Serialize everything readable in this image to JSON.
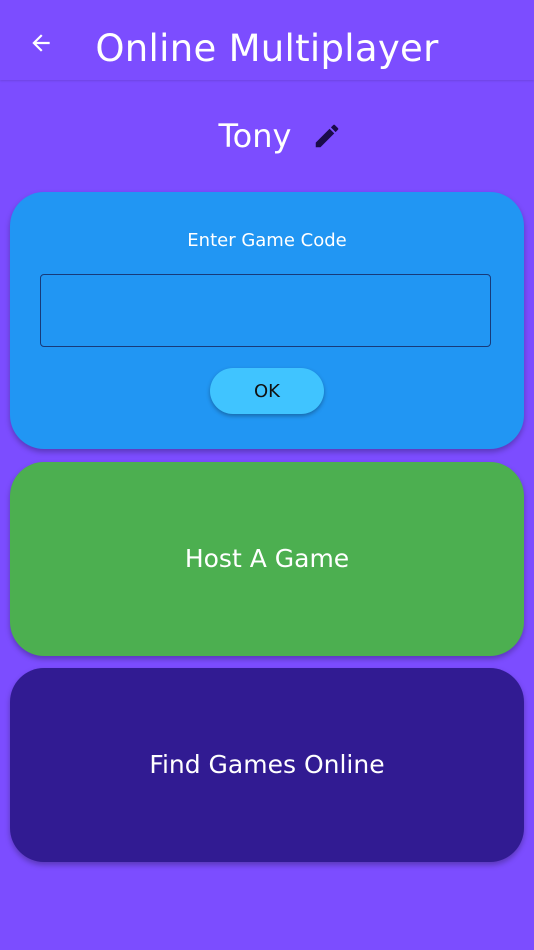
{
  "app_bar": {
    "title": "Online Multiplayer",
    "back_icon": "arrow-left-icon"
  },
  "player": {
    "name": "Tony",
    "edit_icon": "pencil-icon"
  },
  "join_card": {
    "label": "Enter Game Code",
    "input_value": "",
    "ok_label": "OK"
  },
  "host_card": {
    "label": "Host A Game"
  },
  "find_card": {
    "label": "Find Games Online"
  },
  "colors": {
    "background": "#7c4dff",
    "join_card": "#2196f3",
    "ok_button": "#40c4ff",
    "host_card": "#4caf50",
    "find_card": "#311b92"
  }
}
